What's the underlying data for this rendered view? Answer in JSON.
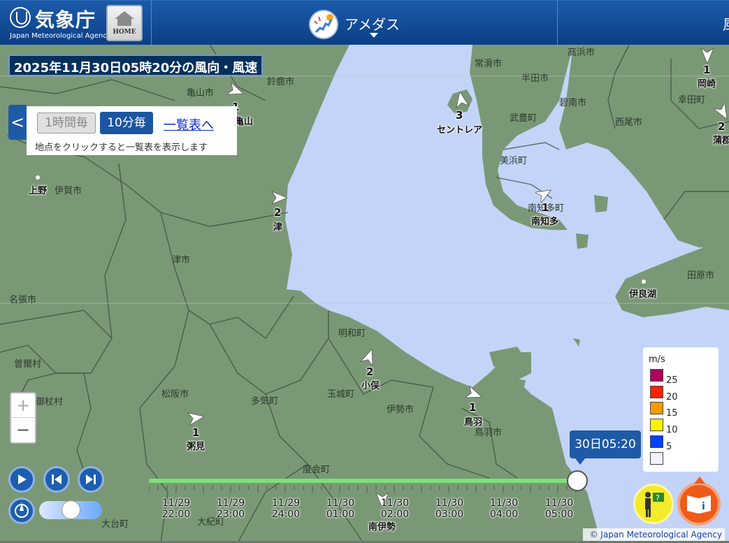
{
  "header": {
    "logo_jp": "気象庁",
    "logo_en": "Japan Meteorological Agency",
    "home_label": "HOME",
    "page_title": "アメダス",
    "cut_text": "風"
  },
  "timestamp": "2025年11月30日05時20分の風向・風速",
  "panel": {
    "btn_hourly": "1時間毎",
    "btn_10min": "10分毎",
    "link_list": "一覧表へ",
    "note": "地点をクリックすると一覧表を表示します",
    "collapse_glyph": "<"
  },
  "zoom": {
    "in": "+",
    "out": "−"
  },
  "places": {
    "kameyama": "亀山市",
    "suzuka": "鈴鹿市",
    "iga": "伊賀市",
    "tsushi": "津市",
    "nabari": "名張市",
    "sone": "曽爾村",
    "mitsue": "御杖村",
    "matsusaka": "松阪市",
    "taki": "多気町",
    "tamaki": "玉城町",
    "meiwa": "明和町",
    "ise": "伊勢市",
    "toba": "鳥羽市",
    "watarai": "度会町",
    "taiki": "大台町",
    "okihara": "大紀町",
    "tokoname": "常滑市",
    "handa": "半田市",
    "taketoyo": "武豊町",
    "mihama": "美浜町",
    "minamichita_town": "南知多町",
    "takahama": "高浜市",
    "hekinan": "碧南市",
    "nishio": "西尾市",
    "kota": "幸田町",
    "tahara": "田原市"
  },
  "stations": {
    "kameyama": {
      "name": "亀山",
      "speed": "1"
    },
    "ueno": {
      "name": "上野"
    },
    "tsu": {
      "name": "津",
      "speed": "2"
    },
    "centrair": {
      "name": "セントレア",
      "speed": "3"
    },
    "minamichita": {
      "name": "南知多",
      "speed": "1"
    },
    "okazaki": {
      "name": "岡崎",
      "speed": "1"
    },
    "gamagori": {
      "name": "蒲郡",
      "speed": "2"
    },
    "irago": {
      "name": "伊良湖"
    },
    "obata": {
      "name": "小俣",
      "speed": "2"
    },
    "toba": {
      "name": "鳥羽",
      "speed": "1"
    },
    "kayumi": {
      "name": "粥見",
      "speed": "1"
    },
    "minamiise": {
      "name": "南伊勢"
    }
  },
  "legend": {
    "unit": "m/s",
    "levels": [
      {
        "label": "25",
        "color": "#b0005e"
      },
      {
        "label": "20",
        "color": "#ff2200"
      },
      {
        "label": "15",
        "color": "#ff9900"
      },
      {
        "label": "10",
        "color": "#fff200"
      },
      {
        "label": "5",
        "color": "#0041ff"
      },
      {
        "label": "",
        "color": "#f2f2ff"
      }
    ]
  },
  "timeline": {
    "current_label": "30日05:20",
    "progress": 1.0,
    "ticks": [
      {
        "date": "11/29",
        "time": "22:00"
      },
      {
        "date": "11/29",
        "time": "23:00"
      },
      {
        "date": "11/29",
        "time": "24:00"
      },
      {
        "date": "11/30",
        "time": "01:00"
      },
      {
        "date": "11/30",
        "time": "02:00"
      },
      {
        "date": "11/30",
        "time": "03:00"
      },
      {
        "date": "11/30",
        "time": "04:00"
      },
      {
        "date": "11/30",
        "time": "05:00"
      }
    ]
  },
  "copyright": "© Japan Meteorological Agency",
  "colors": {
    "land": "#7a9876",
    "sea": "#c3d4f8",
    "header": "#11498f",
    "accent": "#1f5aa6"
  }
}
